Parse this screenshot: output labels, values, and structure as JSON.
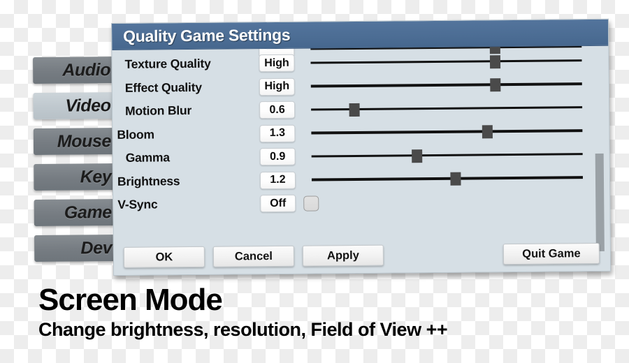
{
  "sidebar": {
    "items": [
      {
        "label": "Audio",
        "selected": false
      },
      {
        "label": "Video",
        "selected": true
      },
      {
        "label": "Mouse",
        "selected": false
      },
      {
        "label": "Key",
        "selected": false
      },
      {
        "label": "Game",
        "selected": false
      },
      {
        "label": "Dev",
        "selected": false
      }
    ]
  },
  "dialog": {
    "title": "Quality Game Settings",
    "settings": [
      {
        "label": "Texture Quality",
        "value": "High",
        "slider": 68
      },
      {
        "label": "Effect Quality",
        "value": "High",
        "slider": 68
      },
      {
        "label": "Motion Blur",
        "value": "0.6",
        "slider": 16
      },
      {
        "label": "Bloom",
        "value": "1.3",
        "slider": 65
      },
      {
        "label": "Gamma",
        "value": "0.9",
        "slider": 39
      },
      {
        "label": "Brightness",
        "value": "1.2",
        "slider": 53
      },
      {
        "label": "V-Sync",
        "value": "Off",
        "checkbox": false
      }
    ],
    "buttons": {
      "ok": "OK",
      "cancel": "Cancel",
      "apply": "Apply",
      "quit": "Quit Game"
    }
  },
  "caption": {
    "title": "Screen Mode",
    "subtitle": "Change brightness, resolution, Field of View ++"
  },
  "colors": {
    "titlebar": "#4c6d94",
    "dialog_body": "#d6dfe5",
    "tab": "#767c82",
    "tab_selected": "#bfc8ce",
    "slider_handle": "#4a4a4a",
    "scrollbar_thumb": "#9aa1a6"
  }
}
